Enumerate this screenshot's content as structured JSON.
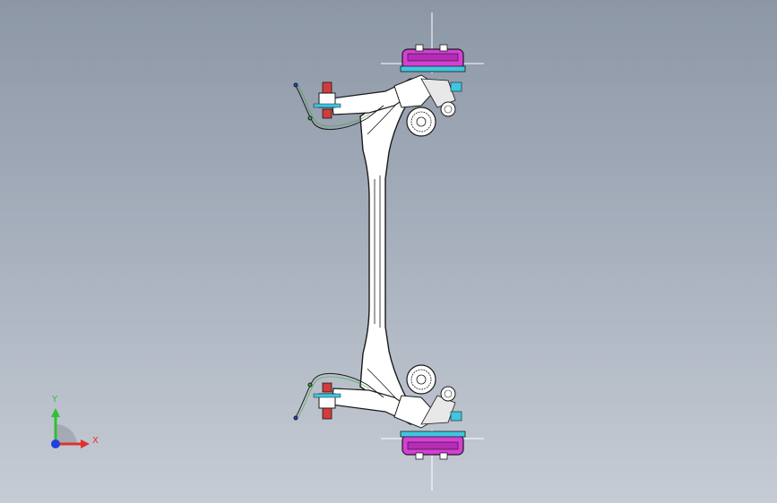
{
  "viewport": {
    "background_top": "#8c97a6",
    "background_bottom": "#c6ccd5"
  },
  "model": {
    "outline_color": "#1a1a1a",
    "body_fill": "#ffffff",
    "accent_magenta": "#d63fd6",
    "accent_cyan": "#3fc6e0",
    "accent_red": "#d23c3c",
    "accent_green": "#3aa63a"
  },
  "triad": {
    "x_label": "X",
    "y_label": "Y",
    "x_color": "#e03030",
    "y_color": "#30c030",
    "z_color": "#2040e0"
  }
}
